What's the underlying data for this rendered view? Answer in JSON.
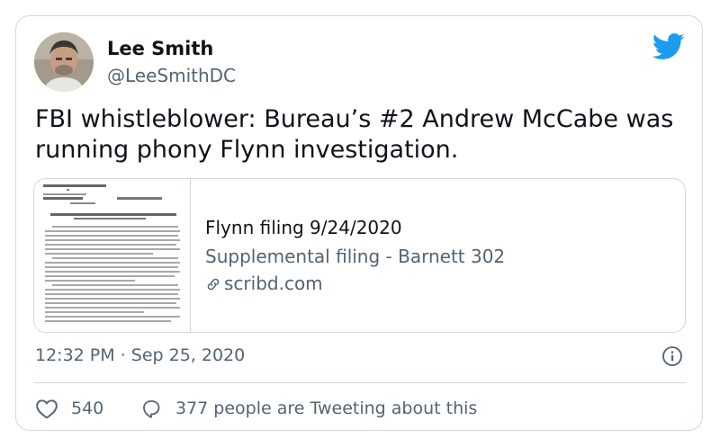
{
  "author": {
    "name": "Lee Smith",
    "handle": "@LeeSmithDC"
  },
  "tweet": {
    "text": "FBI whistleblower: Bureau’s #2 Andrew McCabe was running phony Flynn investigation."
  },
  "link_card": {
    "title": "Flynn filing 9/24/2020",
    "description": "Supplemental filing - Barnett 302",
    "domain": "scribd.com"
  },
  "timestamp": "12:32 PM · Sep 25, 2020",
  "actions": {
    "likes": "540",
    "conversation": "377 people are Tweeting about this"
  },
  "colors": {
    "brand": "#1d9bf0",
    "text_primary": "#0f1419",
    "text_secondary": "#536471",
    "border": "#cfd9de"
  },
  "icons": [
    "twitter-bird-icon",
    "link-icon",
    "info-icon",
    "heart-icon",
    "reply-icon"
  ]
}
